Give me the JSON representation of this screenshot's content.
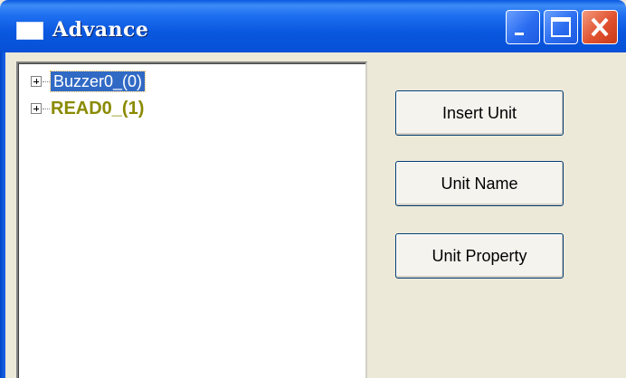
{
  "window": {
    "title": "Advance"
  },
  "tree": {
    "items": [
      {
        "label": "Buzzer0_(0)",
        "selected": true
      },
      {
        "label": "READ0_(1)",
        "selected": false
      }
    ]
  },
  "buttons": {
    "insert_unit": "Insert Unit",
    "unit_name": "Unit Name",
    "unit_property": "Unit Property"
  },
  "colors": {
    "titlebar": "#0a58e0",
    "selection": "#316ac5",
    "item2_text": "#8a8a00",
    "close_button": "#e0512e",
    "dialog_background": "#ece9d8"
  },
  "icons": {
    "window_icon": "window-icon",
    "minimize": "minimize-icon",
    "maximize": "maximize-icon",
    "close": "close-icon",
    "expand": "plus-box-icon"
  }
}
